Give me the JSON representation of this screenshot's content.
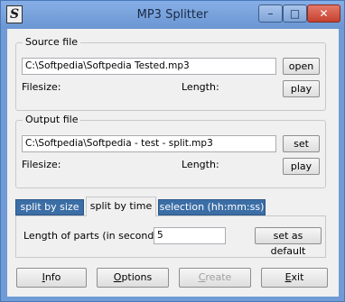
{
  "window": {
    "title": "MP3 Splitter",
    "icon_letter": "S"
  },
  "title_buttons": {
    "minimize": "–",
    "maximize": "□",
    "close": "✕"
  },
  "source": {
    "group_label": "Source file",
    "path": "C:\\Softpedia\\Softpedia Tested.mp3",
    "open_label": "open",
    "filesize_label": "Filesize:",
    "length_label": "Length:",
    "play_label": "play"
  },
  "output": {
    "group_label": "Output file",
    "path": "C:\\Softpedia\\Softpedia - test - split.mp3",
    "set_label": "set",
    "filesize_label": "Filesize:",
    "length_label": "Length:",
    "play_label": "play"
  },
  "tabs": [
    {
      "label": "split by size",
      "active": false
    },
    {
      "label": "split by time",
      "active": true
    },
    {
      "label": "selection (hh:mm:ss)",
      "active": false
    }
  ],
  "split_time": {
    "parts_label": "Length of parts (in seconds):",
    "parts_value": "5",
    "default_label": "set as default"
  },
  "footer": {
    "info": {
      "before": "",
      "underlined": "I",
      "after": "nfo"
    },
    "options": {
      "before": "",
      "underlined": "O",
      "after": "ptions"
    },
    "create": {
      "before": "",
      "underlined": "C",
      "after": "reate",
      "enabled": false
    },
    "exit": {
      "before": "",
      "underlined": "E",
      "after": "xit"
    }
  }
}
